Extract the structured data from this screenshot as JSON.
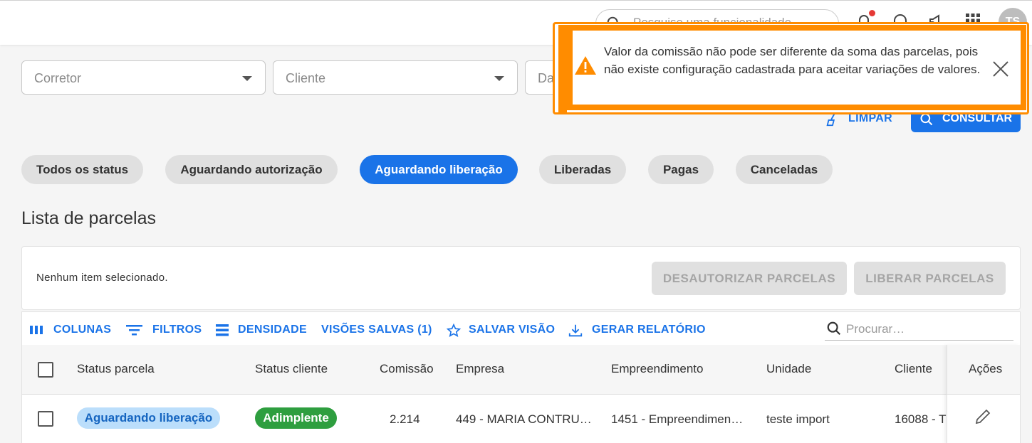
{
  "topbar": {
    "search_placeholder": "Pesquise uma funcionalidade",
    "avatar_initials": "TS",
    "icons": [
      "search-icon",
      "bell-icon",
      "headset-icon",
      "megaphone-icon",
      "apps-grid-icon"
    ]
  },
  "filters": {
    "corretor": "Corretor",
    "cliente": "Cliente",
    "data": "Da",
    "clear_label": "LIMPAR",
    "submit_label": "CONSULTAR"
  },
  "status_chips": [
    {
      "label": "Todos os status",
      "active": false
    },
    {
      "label": "Aguardando autorização",
      "active": false
    },
    {
      "label": "Aguardando liberação",
      "active": true
    },
    {
      "label": "Liberadas",
      "active": false
    },
    {
      "label": "Pagas",
      "active": false
    },
    {
      "label": "Canceladas",
      "active": false
    }
  ],
  "section_title": "Lista de parcelas",
  "selection": {
    "info": "Nenhum item selecionado.",
    "deauthorize_label": "DESAUTORIZAR PARCELAS",
    "release_label": "LIBERAR PARCELAS"
  },
  "toolbar": {
    "columns": "COLUNAS",
    "filters": "FILTROS",
    "density": "DENSIDADE",
    "saved_views": "VISÕES SALVAS (1)",
    "save_view": "SALVAR VISÃO",
    "report": "GERAR RELATÓRIO",
    "search_placeholder": "Procurar…"
  },
  "table": {
    "columns": [
      "Status parcela",
      "Status cliente",
      "Comissão",
      "Empresa",
      "Empreendimento",
      "Unidade",
      "Cliente",
      "Ações"
    ],
    "rows": [
      {
        "status_parcela": "Aguardando liberação",
        "status_cliente": "Adimplente",
        "comissao": "2.214",
        "empresa": "449 - MARIA CONTRU…",
        "empreendimento": "1451 - Empreendimen…",
        "unidade": "teste import",
        "cliente": "16088 - T"
      }
    ]
  },
  "toast": {
    "message": "Valor da comissão não pode ser diferente da soma das parcelas, pois não existe configuração cadastrada para aceitar variações de valores.",
    "color": "#ff8c00"
  },
  "colors": {
    "primary": "#1a73e8",
    "warning": "#ff8c00",
    "badge_pending_bg": "#bbdefb",
    "badge_ok_bg": "#2e9e3f"
  }
}
